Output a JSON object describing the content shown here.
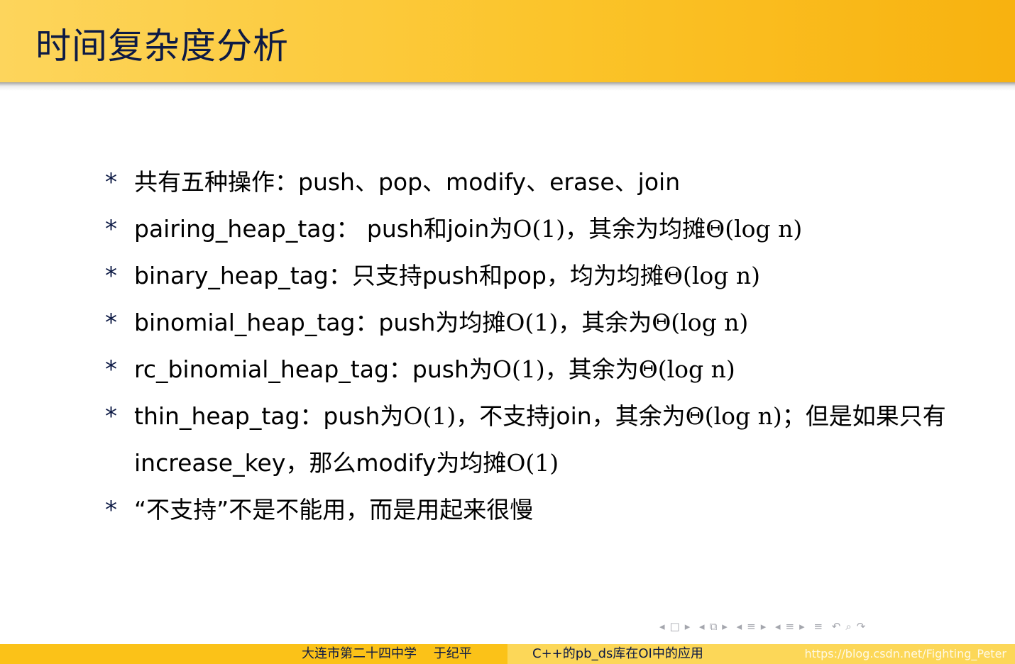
{
  "header": {
    "title": "时间复杂度分析"
  },
  "bullets": [
    {
      "text": "共有五种操作：push、pop、modify、erase、join"
    },
    {
      "prefix": "pairing_heap_tag：  push和join为",
      "math1": "O(1)",
      "mid": "，其余为均摊",
      "math2": "Θ(log n)"
    },
    {
      "prefix": "binary_heap_tag：只支持push和pop，均为均摊",
      "math1": "Θ(log n)"
    },
    {
      "prefix": "binomial_heap_tag：push为均摊",
      "math1": "O(1)",
      "mid": "，其余为",
      "math2": "Θ(log n)"
    },
    {
      "prefix": "rc_binomial_heap_tag：push为",
      "math1": "O(1)",
      "mid": "，其余为",
      "math2": "Θ(log n)"
    },
    {
      "prefix": "thin_heap_tag：push为",
      "math1": "O(1)",
      "mid": "，不支持join，其余为",
      "math2": "Θ(log n)",
      "mid2": "；但是如果只有increase_key，那么modify为均摊",
      "math3": "O(1)"
    },
    {
      "text": "“不支持”不是不能用，而是用起来很慢"
    }
  ],
  "bullet_symbol": "*",
  "nav": {
    "icons": [
      "◂",
      "□",
      "▸",
      "◂",
      "⧉",
      "▸",
      "◂",
      "≡",
      "▸",
      "◂",
      "≡",
      "▸",
      "≡",
      "↶",
      "⌕",
      "↷"
    ]
  },
  "footer": {
    "left": "大连市第二十四中学　 于纪平",
    "right": "C++的pb_ds库在OI中的应用",
    "watermark": "https://blog.csdn.net/Fighting_Peter"
  },
  "colors": {
    "title": "#0d1a45",
    "header_left": "#fdd55c",
    "header_right": "#f8b20f",
    "footer_left": "#fbc218",
    "footer_right": "#fcd758"
  }
}
